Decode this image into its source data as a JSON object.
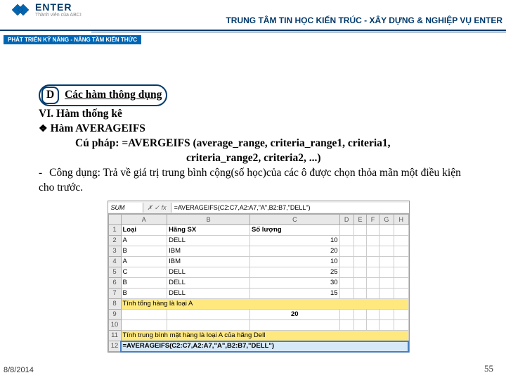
{
  "header": {
    "brand": "ENTER",
    "brand_sub": "Thành viên của ABCI",
    "title": "TRUNG TÂM TIN HỌC KIẾN TRÚC - XÂY DỰNG & NGHIỆP VỤ ENTER",
    "slogan": "PHÁT TRIỂN KỸ NĂNG - NÂNG TẦM KIẾN THỨC"
  },
  "section": {
    "letter": "D",
    "title": "Các hàm thông dụng"
  },
  "body": {
    "h1": "VI. Hàm thống kê",
    "h2": "Hàm AVERAGEIFS",
    "syntax1": "Cú pháp: =AVERGEIFS (average_range, criteria_range1, criteria1,",
    "syntax2": "criteria_range2, criteria2, ...)",
    "desc": "Công dụng: Trả về giá trị trung bình cộng(số học)của các ô được chọn thỏa mãn một điều kiện cho trước."
  },
  "excel": {
    "name_box": "SUM",
    "formula_bar": "=AVERAGEIFS(C2:C7,A2:A7,\"A\",B2:B7,\"DELL\")",
    "cols": [
      "",
      "A",
      "B",
      "C",
      "D",
      "E",
      "F",
      "G",
      "H"
    ],
    "rows": [
      {
        "n": "1",
        "a": "Loại",
        "b": "Hãng SX",
        "c": "Số lượng"
      },
      {
        "n": "2",
        "a": "A",
        "b": "DELL",
        "c": "10"
      },
      {
        "n": "3",
        "a": "B",
        "b": "IBM",
        "c": "20"
      },
      {
        "n": "4",
        "a": "A",
        "b": "IBM",
        "c": "10"
      },
      {
        "n": "5",
        "a": "C",
        "b": "DELL",
        "c": "25"
      },
      {
        "n": "6",
        "a": "B",
        "b": "DELL",
        "c": "30"
      },
      {
        "n": "7",
        "a": "B",
        "b": "DELL",
        "c": "15"
      },
      {
        "n": "8",
        "a": "Tính tổng hàng là loại A",
        "b": "",
        "c": ""
      },
      {
        "n": "9",
        "a": "",
        "b": "",
        "c": "20"
      },
      {
        "n": "10",
        "a": "",
        "b": "",
        "c": ""
      },
      {
        "n": "11",
        "a": "Tính trung bình mặt hàng là loại A của hãng Dell",
        "b": "",
        "c": ""
      },
      {
        "n": "12",
        "a": "=AVERAGEIFS(C2:C7,A2:A7,\"A\",B2:B7,\"DELL\")",
        "b": "",
        "c": ""
      }
    ]
  },
  "footer": {
    "date": "8/8/2014",
    "page": "55"
  }
}
